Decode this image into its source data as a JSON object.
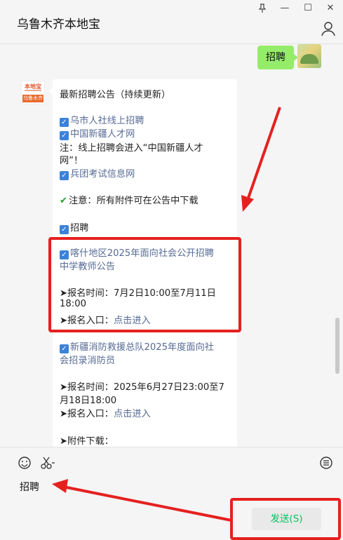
{
  "window": {
    "title": "乌鲁木齐本地宝",
    "pin_icon": "pin-icon",
    "minimize_glyph": "—",
    "maximize_glyph": "☐",
    "close_glyph": "✕"
  },
  "chat": {
    "my_message": "招聘",
    "bot_avatar": {
      "top": "本地宝",
      "bottom": "乌鲁木齐"
    },
    "bot_lines": [
      "最新招聘公告（持续更新）",
      "乌市人社线上招聘",
      "中国新疆人才网",
      "注：线上招聘会进入“中国新疆人才",
      "网”！",
      "兵团考试信息网",
      "注意：所有附件可在公告中下载",
      "招聘",
      "喀什地区2025年面向社会公开招聘",
      "中学教师公告",
      "➤报名时间：7月2日10:00至7月11日",
      "18:00",
      "➤报名入口：",
      "点击进入",
      "新疆消防救援总队2025年度面向社",
      "会招录消防员",
      "➤报名时间：2025年6月27日23:00至7",
      "月18日18:00",
      "➤报名入口：",
      "点击进入",
      "➤附件下载："
    ]
  },
  "input": {
    "emoji_icon": "emoji-icon",
    "scissors_icon": "scissors-icon",
    "history_icon": "chat-history-icon",
    "text": "招聘",
    "send_label": "发送(S)"
  },
  "colors": {
    "annotation_red": "#e5211f",
    "link": "#576b95",
    "my_bubble": "#95ec69",
    "send_text": "#07c160"
  }
}
